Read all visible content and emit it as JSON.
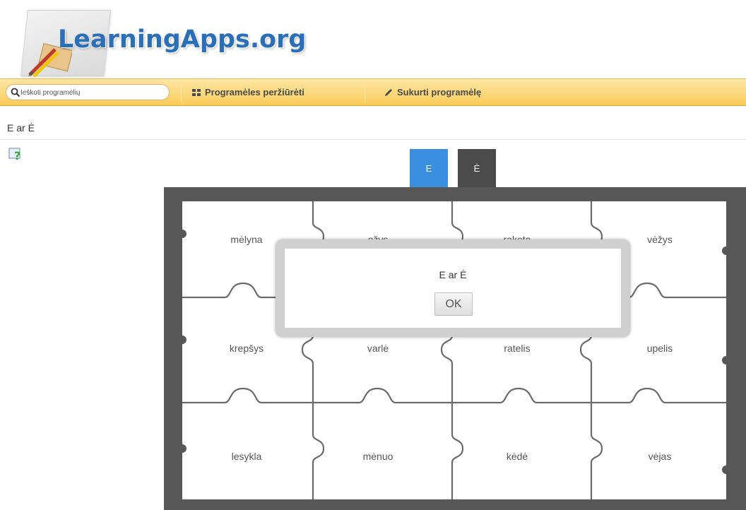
{
  "header": {
    "logo_text": "LearningApps.org"
  },
  "toolbar": {
    "search_placeholder": "Ieškoti programėlių",
    "browse_label": "Programėles peržiūrėti",
    "create_label": "Sukurti programėlę"
  },
  "page": {
    "title": "E ar Ė"
  },
  "tabs": [
    {
      "label": "E",
      "color": "#3a8fe0",
      "selected": true
    },
    {
      "label": "Ė",
      "color": "#4b4b4b",
      "selected": false
    }
  ],
  "puzzle": {
    "rows": [
      [
        "mėlyna",
        "ežys",
        "raketa",
        "vėžys"
      ],
      [
        "krepšys",
        "varlė",
        "ratelis",
        "upelis"
      ],
      [
        "lesykla",
        "mėnuo",
        "kėdė",
        "vėjas"
      ]
    ]
  },
  "modal": {
    "text": "E ar Ė",
    "ok_label": "OK"
  },
  "colors": {
    "accent": "#2a6fb8",
    "toolbar": "#f9cc5a",
    "board": "#575757"
  },
  "icons": [
    "search-icon",
    "grid-icon",
    "pencil-icon",
    "help-icon"
  ]
}
